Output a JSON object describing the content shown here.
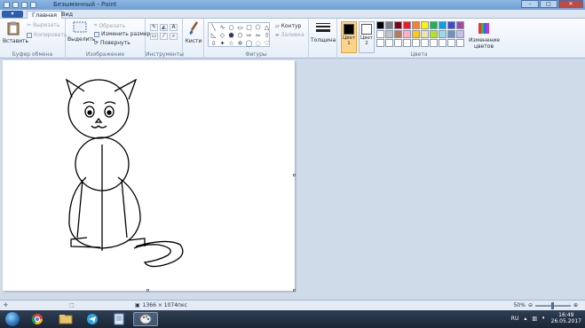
{
  "window": {
    "title": "Безымянный - Paint"
  },
  "tabs": {
    "file": "▾",
    "home": "Главная",
    "view": "Вид"
  },
  "clipboard": {
    "paste": "Вставить",
    "cut": "Вырезать",
    "copy": "Копировать",
    "label": "Буфер обмена"
  },
  "image": {
    "select": "Выделить",
    "crop": "Обрезать",
    "resize": "Изменить размер",
    "rotate": "Повернуть",
    "label": "Изображение"
  },
  "tools": {
    "label": "Инструменты"
  },
  "brushes": {
    "label": "Кисти"
  },
  "shapes": {
    "outline": "Контур",
    "fill": "Заливка",
    "label": "Фигуры"
  },
  "size": {
    "label": "Толщина"
  },
  "colors": {
    "color1": "Цвет 1",
    "color2": "Цвет 2",
    "edit": "Изменение цветов",
    "label": "Цвета",
    "color1_value": "#000000",
    "color2_value": "#ffffff",
    "palette": [
      "#000000",
      "#7f7f7f",
      "#880015",
      "#ed1c24",
      "#ff7f27",
      "#fff200",
      "#22b14c",
      "#00a2e8",
      "#3f48cc",
      "#a349a4",
      "#ffffff",
      "#c3c3c3",
      "#b97a57",
      "#ffaec9",
      "#ffc90e",
      "#efe4b0",
      "#b5e61d",
      "#99d9ea",
      "#7092be",
      "#c8bfe7",
      "#ffffff",
      "#ffffff",
      "#ffffff",
      "#ffffff",
      "#ffffff",
      "#ffffff",
      "#ffffff",
      "#ffffff",
      "#ffffff",
      "#ffffff"
    ]
  },
  "status": {
    "canvas_size": "1366 × 1074пкс",
    "zoom": "50%"
  },
  "taskbar": {
    "lang": "RU",
    "time": "16:49",
    "date": "26.05.2017"
  }
}
